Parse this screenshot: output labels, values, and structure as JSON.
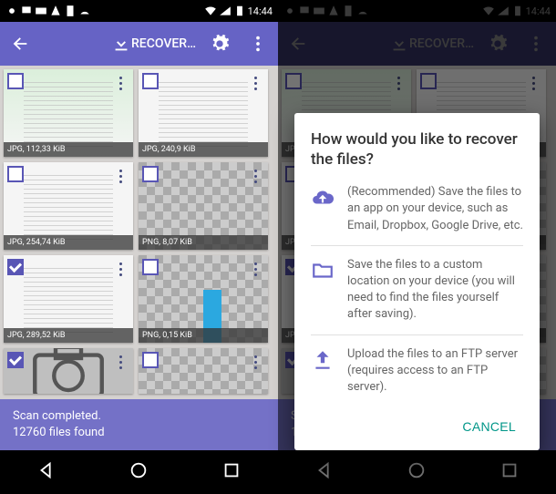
{
  "statusbar": {
    "time": "14:44"
  },
  "toolbar": {
    "back": "back",
    "recover_label": "RECOVER…"
  },
  "tiles": [
    {
      "label": "JPG, 112,33 KiB",
      "checked": false,
      "kind": "doc-green"
    },
    {
      "label": "JPG, 240,9 KiB",
      "checked": false,
      "kind": "doc"
    },
    {
      "label": "JPG, 254,74 KiB",
      "checked": false,
      "kind": "doc-blur"
    },
    {
      "label": "PNG, 8,07 KiB",
      "checked": false,
      "kind": "checker"
    },
    {
      "label": "JPG, 289,52 KiB",
      "checked": true,
      "kind": "doc"
    },
    {
      "label": "PNG, 0,15 KiB",
      "checked": false,
      "kind": "checker-bar"
    },
    {
      "label": "",
      "checked": true,
      "kind": "camera",
      "partial": true
    },
    {
      "label": "",
      "checked": false,
      "kind": "checker",
      "partial": true
    }
  ],
  "status": {
    "line1": "Scan completed.",
    "line2": "12760 files found"
  },
  "dialog": {
    "title": "How would you like to recover the files?",
    "options": [
      {
        "icon": "cloud-upload",
        "text": "(Recommended) Save the files to an app on your device, such as Email, Dropbox, Google Drive, etc."
      },
      {
        "icon": "folder",
        "text": "Save the files to a custom location on your device (you will need to find the files yourself after saving)."
      },
      {
        "icon": "upload",
        "text": "Upload the files to an FTP server (requires access to an FTP server)."
      }
    ],
    "cancel_label": "CANCEL"
  }
}
